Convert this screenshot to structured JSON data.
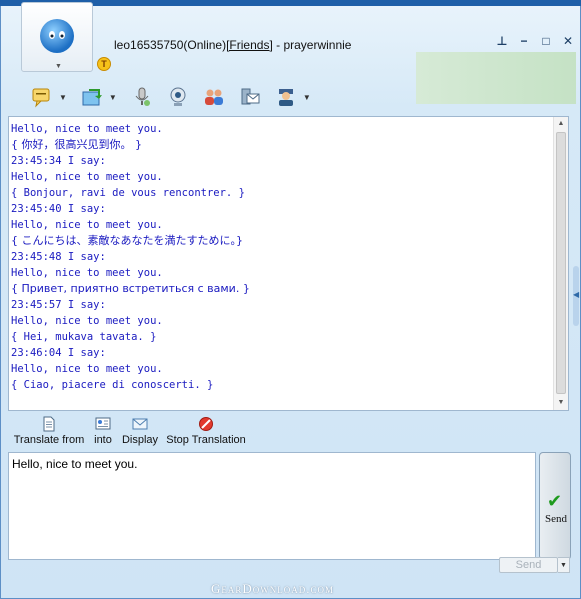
{
  "header": {
    "title_prefix": "leo16535750(Online)",
    "friends_link": "[Friends]",
    "title_suffix": " - prayerwinnie",
    "status_badge": "T"
  },
  "window_controls": {
    "pin": "⊥",
    "minimize": "−",
    "maximize": "□",
    "close": "✕"
  },
  "toolbar": {
    "items": [
      {
        "icon": "chat-bubble-icon",
        "has_dropdown": true
      },
      {
        "icon": "send-file-icon",
        "has_dropdown": true
      },
      {
        "icon": "microphone-icon",
        "has_dropdown": false
      },
      {
        "icon": "webcam-icon",
        "has_dropdown": false
      },
      {
        "icon": "group-icon",
        "has_dropdown": false
      },
      {
        "icon": "mail-icon",
        "has_dropdown": false
      },
      {
        "icon": "user-card-icon",
        "has_dropdown": true
      }
    ]
  },
  "chat": {
    "lines": [
      "Hello, nice to meet you.",
      "{ 你好，很高兴见到你。 }",
      "23:45:34 I say:",
      "Hello, nice to meet you.",
      "{ Bonjour, ravi de vous rencontrer. }",
      "23:45:40 I say:",
      "Hello, nice to meet you.",
      "{ こんにちは、素敵なあなたを満たすために。}",
      "23:45:48 I say:",
      "Hello, nice to meet you.",
      "{ Привет, приятно встретиться с вами. }",
      "23:45:57 I say:",
      "Hello, nice to meet you.",
      "{ Hei, mukava tavata. }",
      "23:46:04 I say:",
      "Hello, nice to meet you.",
      "{ Ciao, piacere di conoscerti. }"
    ]
  },
  "translation_bar": {
    "translate_from": "Translate from",
    "into": "into",
    "display": "Display",
    "stop": "Stop Translation"
  },
  "input": {
    "value": "Hello, nice to meet you."
  },
  "send": {
    "big_label": "Send",
    "small_label": "Send"
  },
  "watermark": "GearDownload.com",
  "colors": {
    "chat_text": "#1a1ac0",
    "window_bg": "#d6e9f7",
    "accent": "#1e5fa8"
  }
}
